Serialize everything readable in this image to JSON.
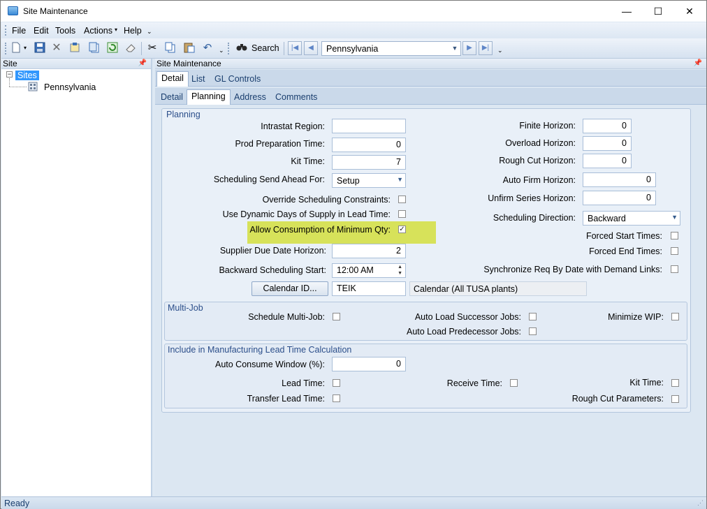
{
  "window": {
    "title": "Site Maintenance",
    "minimize": "—",
    "maximize": "☐",
    "close": "✕"
  },
  "menu": {
    "items": [
      "File",
      "Edit",
      "Tools",
      "Actions",
      "Help"
    ]
  },
  "toolbar": {
    "search_label": "Search",
    "site_value": "Pennsylvania"
  },
  "left_pane": {
    "header": "Site",
    "tree": {
      "root": "Sites",
      "child": "Pennsylvania"
    }
  },
  "main": {
    "header": "Site Maintenance",
    "top_tabs": [
      "Detail",
      "List",
      "GL Controls"
    ],
    "sub_tabs": [
      "Detail",
      "Planning",
      "Address",
      "Comments"
    ],
    "planning": {
      "title": "Planning",
      "intrastat_region_label": "Intrastat Region:",
      "intrastat_region_value": "",
      "prod_prep_time_label": "Prod Preparation Time:",
      "prod_prep_time_value": "0",
      "kit_time_label": "Kit Time:",
      "kit_time_value": "7",
      "sched_send_ahead_label": "Scheduling Send Ahead For:",
      "sched_send_ahead_value": "Setup",
      "override_constraints_label": "Override Scheduling Constraints:",
      "dynamic_days_label": "Use Dynamic Days of Supply in Lead Time:",
      "allow_min_qty_label": "Allow Consumption of Minimum Qty:",
      "allow_min_qty_check": "✓",
      "supplier_due_label": "Supplier Due Date Horizon:",
      "supplier_due_value": "2",
      "backward_start_label": "Backward Scheduling Start:",
      "backward_start_value": "12:00 AM",
      "calendar_button": "Calendar ID...",
      "calendar_id_value": "TEIK",
      "calendar_desc": "Calendar (All TUSA plants)",
      "finite_horizon_label": "Finite Horizon:",
      "finite_horizon_value": "0",
      "overload_horizon_label": "Overload Horizon:",
      "overload_horizon_value": "0",
      "rough_cut_horizon_label": "Rough Cut Horizon:",
      "rough_cut_horizon_value": "0",
      "auto_firm_label": "Auto Firm Horizon:",
      "auto_firm_value": "0",
      "unfirm_series_label": "Unfirm Series Horizon:",
      "unfirm_series_value": "0",
      "sched_direction_label": "Scheduling Direction:",
      "sched_direction_value": "Backward",
      "forced_start_label": "Forced Start Times:",
      "forced_end_label": "Forced End Times:",
      "sync_req_label": "Synchronize Req By Date with Demand Links:"
    },
    "multi_job": {
      "title": "Multi-Job",
      "schedule_label": "Schedule Multi-Job:",
      "auto_succ_label": "Auto Load Successor Jobs:",
      "auto_pred_label": "Auto Load Predecessor Jobs:",
      "min_wip_label": "Minimize WIP:"
    },
    "lead_time": {
      "title": "Include in Manufacturing Lead Time Calculation",
      "auto_consume_label": "Auto Consume Window (%):",
      "auto_consume_value": "0",
      "lead_time_label": "Lead Time:",
      "receive_time_label": "Receive Time:",
      "kit_time_label": "Kit Time:",
      "transfer_label": "Transfer Lead Time:",
      "rough_cut_params_label": "Rough Cut Parameters:"
    }
  },
  "status": {
    "text": "Ready"
  }
}
